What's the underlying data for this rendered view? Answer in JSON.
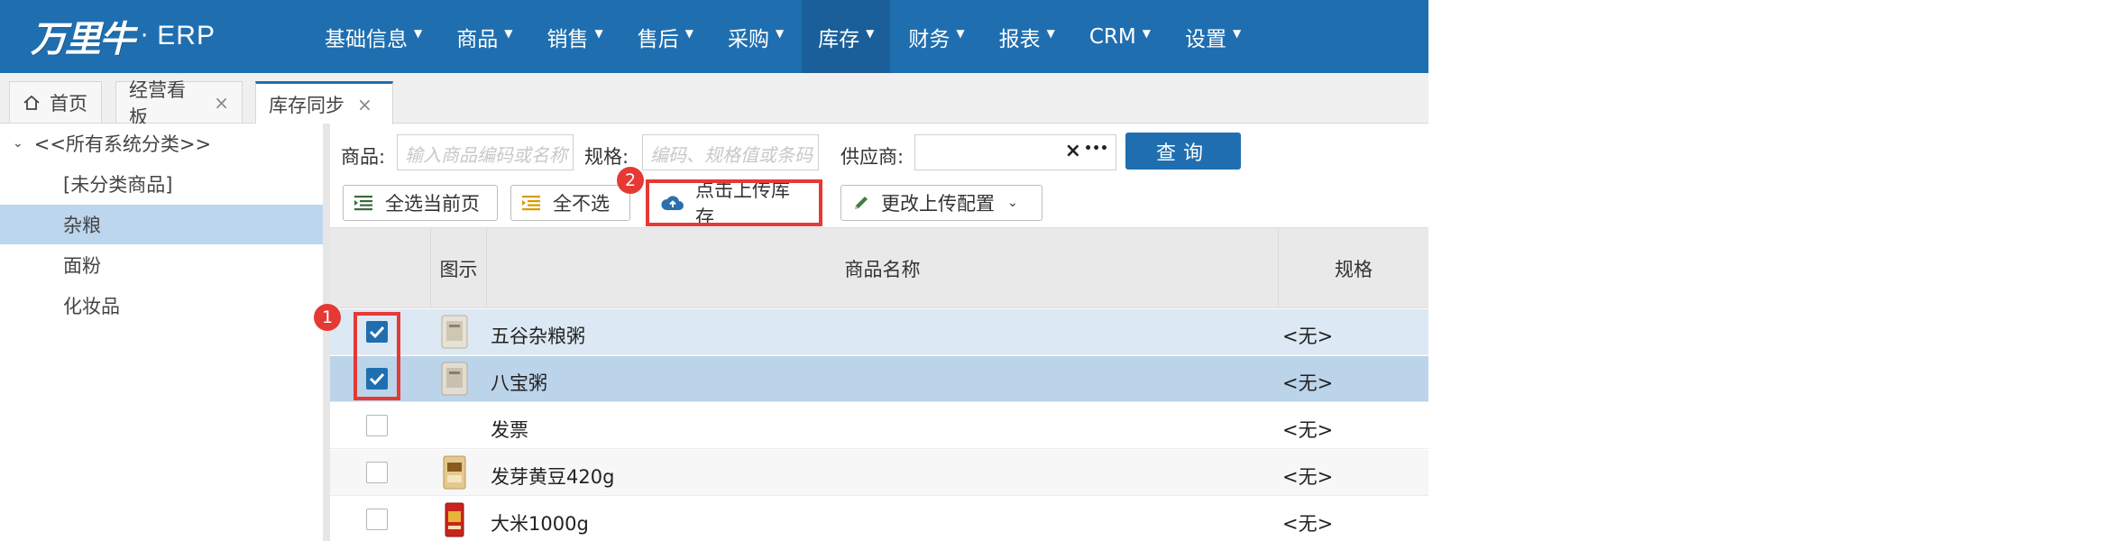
{
  "app": {
    "logo_mark": "万里牛",
    "logo_dot": "·",
    "logo_text": "ERP"
  },
  "nav": {
    "items": [
      {
        "label": "基础信息"
      },
      {
        "label": "商品"
      },
      {
        "label": "销售"
      },
      {
        "label": "售后"
      },
      {
        "label": "采购"
      },
      {
        "label": "库存",
        "active": true
      },
      {
        "label": "财务"
      },
      {
        "label": "报表"
      },
      {
        "label": "CRM"
      },
      {
        "label": "设置"
      }
    ]
  },
  "tabs": [
    {
      "label": "首页"
    },
    {
      "label": "经营看板",
      "closable": true
    },
    {
      "label": "库存同步",
      "closable": true,
      "active": true
    }
  ],
  "tab_close_glyph": "×",
  "tree": {
    "root": "<<所有系统分类>>",
    "items": [
      "[未分类商品]",
      "杂粮",
      "面粉",
      "化妆品"
    ],
    "selected": "杂粮"
  },
  "filters": {
    "product_label": "商品:",
    "product_placeholder": "输入商品编码或名称",
    "spec_label": "规格:",
    "spec_placeholder": "编码、规格值或条码",
    "supplier_label": "供应商:",
    "supplier_clear": "×",
    "supplier_more": "•••",
    "query_label": "查询"
  },
  "toolbar": {
    "select_page_label": "全选当前页",
    "select_none_label": "全不选",
    "upload_label": "点击上传库存",
    "config_label": "更改上传配置"
  },
  "annotations": {
    "badge1": "1",
    "badge2": "2"
  },
  "table": {
    "headers": {
      "image": "图示",
      "name": "商品名称",
      "spec": "规格"
    },
    "rows": [
      {
        "name": "五谷杂粮粥",
        "spec": "<无>",
        "checked": true,
        "thumb": "grain-bag"
      },
      {
        "name": "八宝粥",
        "spec": "<无>",
        "checked": true,
        "thumb": "grain-bag"
      },
      {
        "name": "发票",
        "spec": "<无>",
        "checked": false,
        "thumb": ""
      },
      {
        "name": "发芽黄豆420g",
        "spec": "<无>",
        "checked": false,
        "thumb": "bean-pack"
      },
      {
        "name": "大米1000g",
        "spec": "<无>",
        "checked": false,
        "thumb": "rice-bag"
      }
    ]
  },
  "colors": {
    "primary": "#1f6fb0",
    "selected_row": "#bcd4ea",
    "highlight": "#e53935"
  }
}
